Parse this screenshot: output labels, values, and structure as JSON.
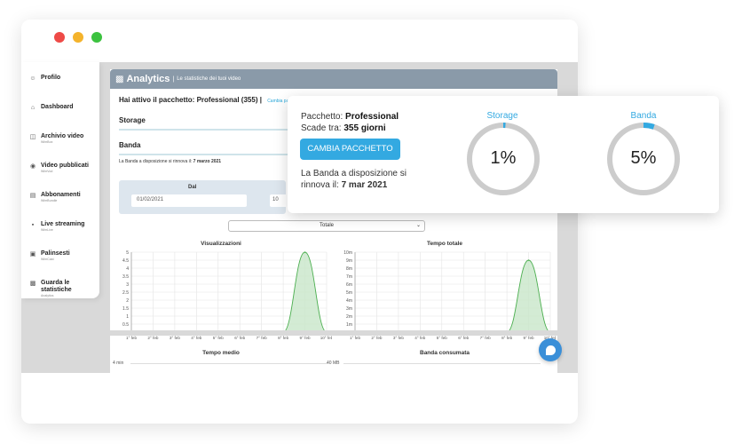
{
  "sidebar": {
    "items": [
      {
        "icon": "user-icon",
        "label": "Profilo",
        "sub": ""
      },
      {
        "icon": "home-icon",
        "label": "Dashboard",
        "sub": ""
      },
      {
        "icon": "folder-icon",
        "label": "Archivio video",
        "sub": "WimBox"
      },
      {
        "icon": "broadcast-icon",
        "label": "Video pubblicati",
        "sub": "WimVod"
      },
      {
        "icon": "card-icon",
        "label": "Abbonamenti",
        "sub": "WimBundle"
      },
      {
        "icon": "camera-icon",
        "label": "Live streaming",
        "sub": "WimLive"
      },
      {
        "icon": "calendar-icon",
        "label": "Palinsesti",
        "sub": "WimCast"
      },
      {
        "icon": "chart-icon",
        "label": "Guarda le statistiche",
        "sub": "Analytics"
      }
    ]
  },
  "main": {
    "title": "Analytics",
    "subtitle": "Le statistiche dei tuoi video",
    "plan_text": "Hai attivo il pacchetto: Professional (355) |",
    "change_link": "Cambia pa",
    "storage_label": "Storage",
    "banda_label": "Banda",
    "renew_small_prefix": "La Banda a disposizione si rinnova il:",
    "renew_small_date": "7 marzo 2021",
    "date_from_label": "Dal",
    "date_from_value": "01/02/2021",
    "date_to_value": "10",
    "select_value": "Totale"
  },
  "popup": {
    "package_prefix": "Pacchetto:",
    "package_name": "Professional",
    "expiry_prefix": "Scade tra:",
    "expiry_value": "355 giorni",
    "change_button": "CAMBIA PACCHETTO",
    "renew_line1": "La Banda a disposizione si",
    "renew_line2_prefix": "rinnova il:",
    "renew_date": "7 mar 2021",
    "storage_label": "Storage",
    "storage_value": "1%",
    "storage_percent": 1,
    "banda_label": "Banda",
    "banda_value": "5%",
    "banda_percent": 5
  },
  "colors": {
    "accent": "#33a9e1",
    "header": "#8a9aa9",
    "gauge_track": "#cccccc",
    "chart_line": "#4caf50",
    "chart_fill": "#c8e6c9"
  },
  "chart_data": [
    {
      "type": "area",
      "title": "Visualizzazioni",
      "x": [
        "1° feb",
        "2° feb",
        "3° feb",
        "4° feb",
        "5° feb",
        "6° feb",
        "7° feb",
        "8° feb",
        "9° feb",
        "10° feb"
      ],
      "values": [
        0,
        0,
        0,
        0,
        0,
        0,
        0,
        0,
        5,
        0
      ],
      "yticks": [
        "0",
        "0.5",
        "1",
        "1.5",
        "2",
        "2.5",
        "3",
        "3.5",
        "4",
        "4.5",
        "5"
      ],
      "ylim": [
        0,
        5
      ]
    },
    {
      "type": "area",
      "title": "Tempo totale",
      "x": [
        "1° feb",
        "2° feb",
        "3° feb",
        "4° feb",
        "5° feb",
        "6° feb",
        "7° feb",
        "8° feb",
        "9° feb",
        "10° feb"
      ],
      "values": [
        0,
        0,
        0,
        0,
        0,
        0,
        0,
        0,
        9,
        0
      ],
      "yticks": [
        "0",
        "1m",
        "2m",
        "3m",
        "4m",
        "5m",
        "6m",
        "7m",
        "8m",
        "9m",
        "10m"
      ],
      "ylim": [
        0,
        10
      ]
    },
    {
      "type": "area",
      "title": "Tempo medio",
      "yticks": [
        "4 min"
      ]
    },
    {
      "type": "area",
      "title": "Banda consumata",
      "yticks": [
        "40 MB"
      ]
    }
  ]
}
